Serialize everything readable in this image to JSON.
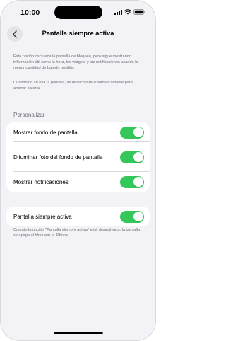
{
  "status_bar": {
    "time": "10:00"
  },
  "header": {
    "title": "Pantalla siempre activa"
  },
  "intro_text": "Esta opción oscurece la pantalla de bloqueo, pero sigue mostrando información útil como la hora, los widgets y las notificaciones usando la menor cantidad de batería posible.",
  "auto_off_text": "Cuando no se usa la pantalla, se desactivará automáticamente para ahorrar batería.",
  "personalize": {
    "header": "Personalizar",
    "rows": [
      {
        "label": "Mostrar fondo de pantalla",
        "on": true
      },
      {
        "label": "Difuminar foto del fondo de pantalla",
        "on": true
      },
      {
        "label": "Mostrar notificaciones",
        "on": true
      }
    ]
  },
  "main_toggle": {
    "label": "Pantalla siempre activa",
    "on": true
  },
  "footer_text": "Cuando la opción \"Pantalla siempre activa\" está desactivada, la pantalla se apaga al bloquear el iPhone.",
  "colors": {
    "accent_on": "#34c759",
    "background": "#f2f2f7",
    "secondary_text": "#6d6d72"
  },
  "icons": {
    "back": "chevron-left-icon",
    "signal": "cellular-signal-icon",
    "wifi": "wifi-icon",
    "battery": "battery-icon"
  }
}
